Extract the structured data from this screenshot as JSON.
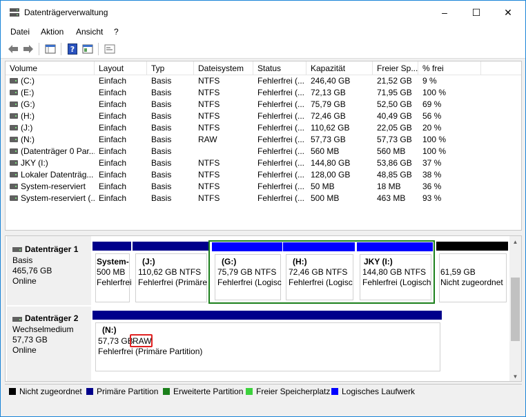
{
  "window": {
    "title": "Datenträgerverwaltung",
    "minimize": "–",
    "maximize": "☐",
    "close": "✕"
  },
  "menu": [
    {
      "label": "Datei"
    },
    {
      "label": "Aktion"
    },
    {
      "label": "Ansicht"
    },
    {
      "label": "?"
    }
  ],
  "toolbar": {
    "icons": [
      "back-arrow-icon",
      "forward-arrow-icon",
      "disk-list-icon",
      "help-icon",
      "properties-icon",
      "console-icon"
    ]
  },
  "table": {
    "columns": [
      "Volume",
      "Layout",
      "Typ",
      "Dateisystem",
      "Status",
      "Kapazität",
      "Freier Sp...",
      "% frei"
    ],
    "rows": [
      [
        "(C:)",
        "Einfach",
        "Basis",
        "NTFS",
        "Fehlerfrei (...",
        "246,40 GB",
        "21,52 GB",
        "9 %"
      ],
      [
        "(E:)",
        "Einfach",
        "Basis",
        "NTFS",
        "Fehlerfrei (...",
        "72,13 GB",
        "71,95 GB",
        "100 %"
      ],
      [
        "(G:)",
        "Einfach",
        "Basis",
        "NTFS",
        "Fehlerfrei (...",
        "75,79 GB",
        "52,50 GB",
        "69 %"
      ],
      [
        "(H:)",
        "Einfach",
        "Basis",
        "NTFS",
        "Fehlerfrei (...",
        "72,46 GB",
        "40,49 GB",
        "56 %"
      ],
      [
        "(J:)",
        "Einfach",
        "Basis",
        "NTFS",
        "Fehlerfrei (...",
        "110,62 GB",
        "22,05 GB",
        "20 %"
      ],
      [
        "(N:)",
        "Einfach",
        "Basis",
        "RAW",
        "Fehlerfrei (...",
        "57,73 GB",
        "57,73 GB",
        "100 %"
      ],
      [
        "(Datenträger 0 Par...",
        "Einfach",
        "Basis",
        "",
        "Fehlerfrei (...",
        "560 MB",
        "560 MB",
        "100 %"
      ],
      [
        "JKY (I:)",
        "Einfach",
        "Basis",
        "NTFS",
        "Fehlerfrei (...",
        "144,80 GB",
        "53,86 GB",
        "37 %"
      ],
      [
        "Lokaler Datenträg...",
        "Einfach",
        "Basis",
        "NTFS",
        "Fehlerfrei (...",
        "128,00 GB",
        "48,85 GB",
        "38 %"
      ],
      [
        "System-reserviert",
        "Einfach",
        "Basis",
        "NTFS",
        "Fehlerfrei (...",
        "50 MB",
        "18 MB",
        "36 %"
      ],
      [
        "System-reserviert (...",
        "Einfach",
        "Basis",
        "NTFS",
        "Fehlerfrei (...",
        "500 MB",
        "463 MB",
        "93 %"
      ]
    ]
  },
  "disk1": {
    "name": "Datenträger 1",
    "type": "Basis",
    "size": "465,76 GB",
    "state": "Online",
    "partitions": [
      {
        "title": "System-",
        "line1": "500 MB",
        "line2": "Fehlerfrei"
      },
      {
        "title": "(J:)",
        "line1": "110,62 GB NTFS",
        "line2": "Fehlerfrei (Primäre"
      },
      {
        "title": "(G:)",
        "line1": "75,79 GB NTFS",
        "line2": "Fehlerfrei (Logisc"
      },
      {
        "title": "(H:)",
        "line1": "72,46 GB NTFS",
        "line2": "Fehlerfrei (Logisc"
      },
      {
        "title": "JKY  (I:)",
        "line1": "144,80 GB NTFS",
        "line2": "Fehlerfrei (Logisch"
      },
      {
        "title": "",
        "line1": "61,59 GB",
        "line2": "Nicht zugeordnet"
      }
    ]
  },
  "disk2": {
    "name": "Datenträger 2",
    "type": "Wechselmedium",
    "size": "57,73 GB",
    "state": "Online",
    "partition": {
      "title": "(N:)",
      "size": "57,73 GB",
      "fs": "RAW",
      "line2": "Fehlerfrei (Primäre Partition)"
    }
  },
  "legend": [
    {
      "label": "Nicht zugeordnet",
      "color": "#000000"
    },
    {
      "label": "Primäre Partition",
      "color": "#00008b"
    },
    {
      "label": "Erweiterte Partition",
      "color": "#1a7f1a"
    },
    {
      "label": "Freier Speicherplatz",
      "color": "#3cd23c"
    },
    {
      "label": "Logisches Laufwerk",
      "color": "#0000ff"
    }
  ]
}
